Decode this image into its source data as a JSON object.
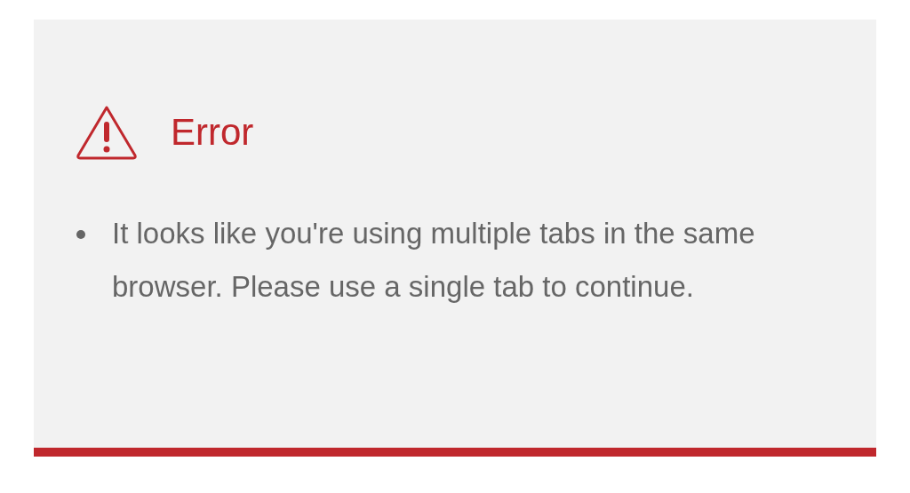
{
  "alert": {
    "title": "Error",
    "messages": [
      "It looks like you're using multiple tabs in the same browser. Please use a single tab to continue."
    ]
  }
}
